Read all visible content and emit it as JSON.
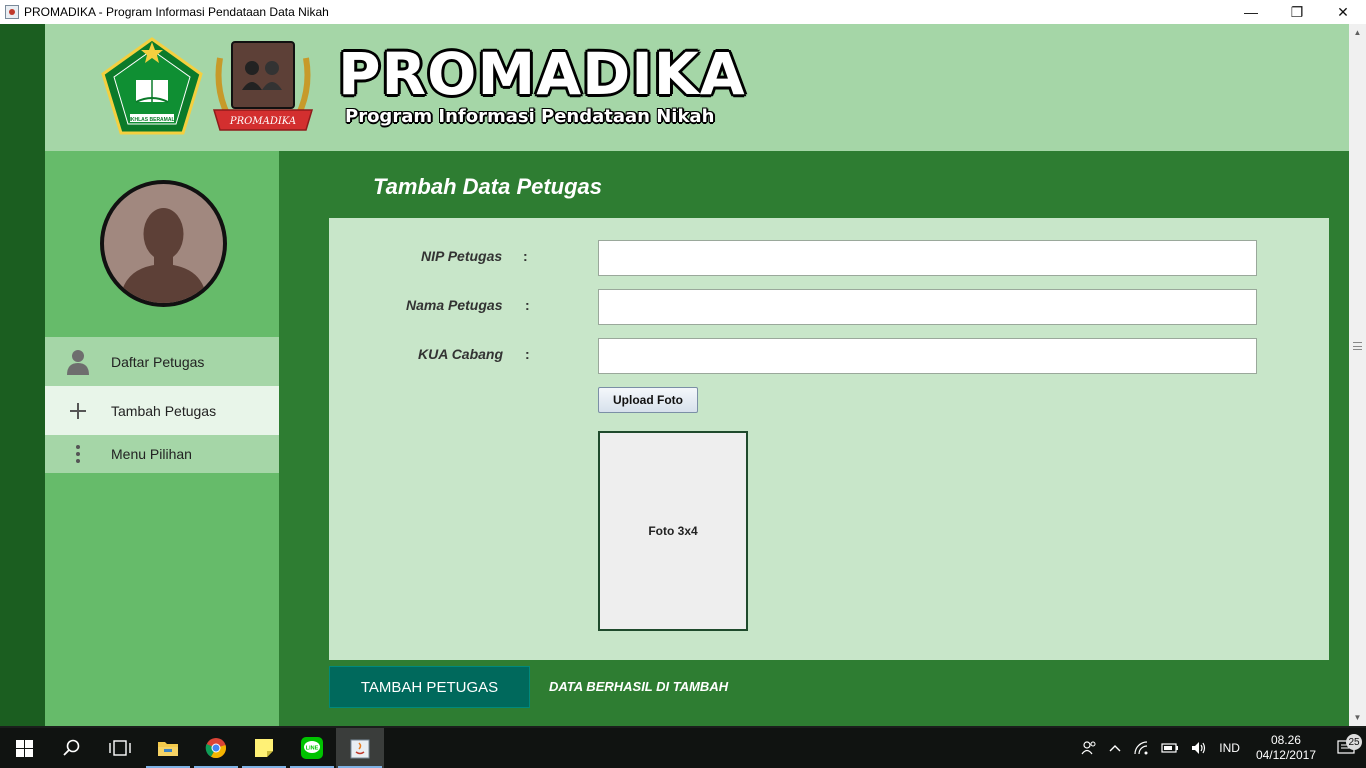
{
  "window": {
    "title": "PROMADIKA - Program Informasi Pendataan Data Nikah",
    "minimize_glyph": "—",
    "maximize_glyph": "❐",
    "close_glyph": "✕"
  },
  "header": {
    "brand_title": "PROMADIKA",
    "brand_subtitle": "Program Informasi Pendataan Nikah",
    "logo_left": "kemenag-emblem-icon",
    "logo_right": "promadika-logo-icon",
    "logo_left_caption": "IKHLAS BERAMAL",
    "logo_right_ribbon": "PROMADIKA"
  },
  "sidebar": {
    "avatar": "user-avatar-icon",
    "items": [
      {
        "label": "Daftar Petugas",
        "icon": "user-icon"
      },
      {
        "label": "Tambah Petugas",
        "icon": "plus-icon"
      },
      {
        "label": "Menu Pilihan",
        "icon": "vertical-dots-icon"
      }
    ]
  },
  "main": {
    "page_title": "Tambah Data Petugas",
    "fields": [
      {
        "label": "NIP Petugas",
        "colon": ":",
        "value": ""
      },
      {
        "label": "Nama Petugas",
        "colon": ":",
        "value": ""
      },
      {
        "label": "KUA Cabang",
        "colon": ":",
        "value": ""
      }
    ],
    "upload_button": "Upload Foto",
    "photo_placeholder": "Foto 3x4",
    "submit_button": "TAMBAH PETUGAS",
    "status_message": "DATA BERHASIL DI TAMBAH"
  },
  "taskbar": {
    "apps": [
      "windows-start-icon",
      "search-icon",
      "task-view-icon",
      "file-explorer-icon",
      "chrome-icon",
      "sticky-notes-icon",
      "line-icon",
      "java-app-icon"
    ],
    "language": "IND",
    "time": "08.26",
    "date": "04/12/2017",
    "notification_count": "25"
  },
  "colors": {
    "header_bg": "#a5d6a7",
    "sidebar_bg": "#66bb6a",
    "main_bg": "#2e7d32",
    "panel_bg": "#c8e6c9",
    "submit_bg": "#00695c"
  }
}
